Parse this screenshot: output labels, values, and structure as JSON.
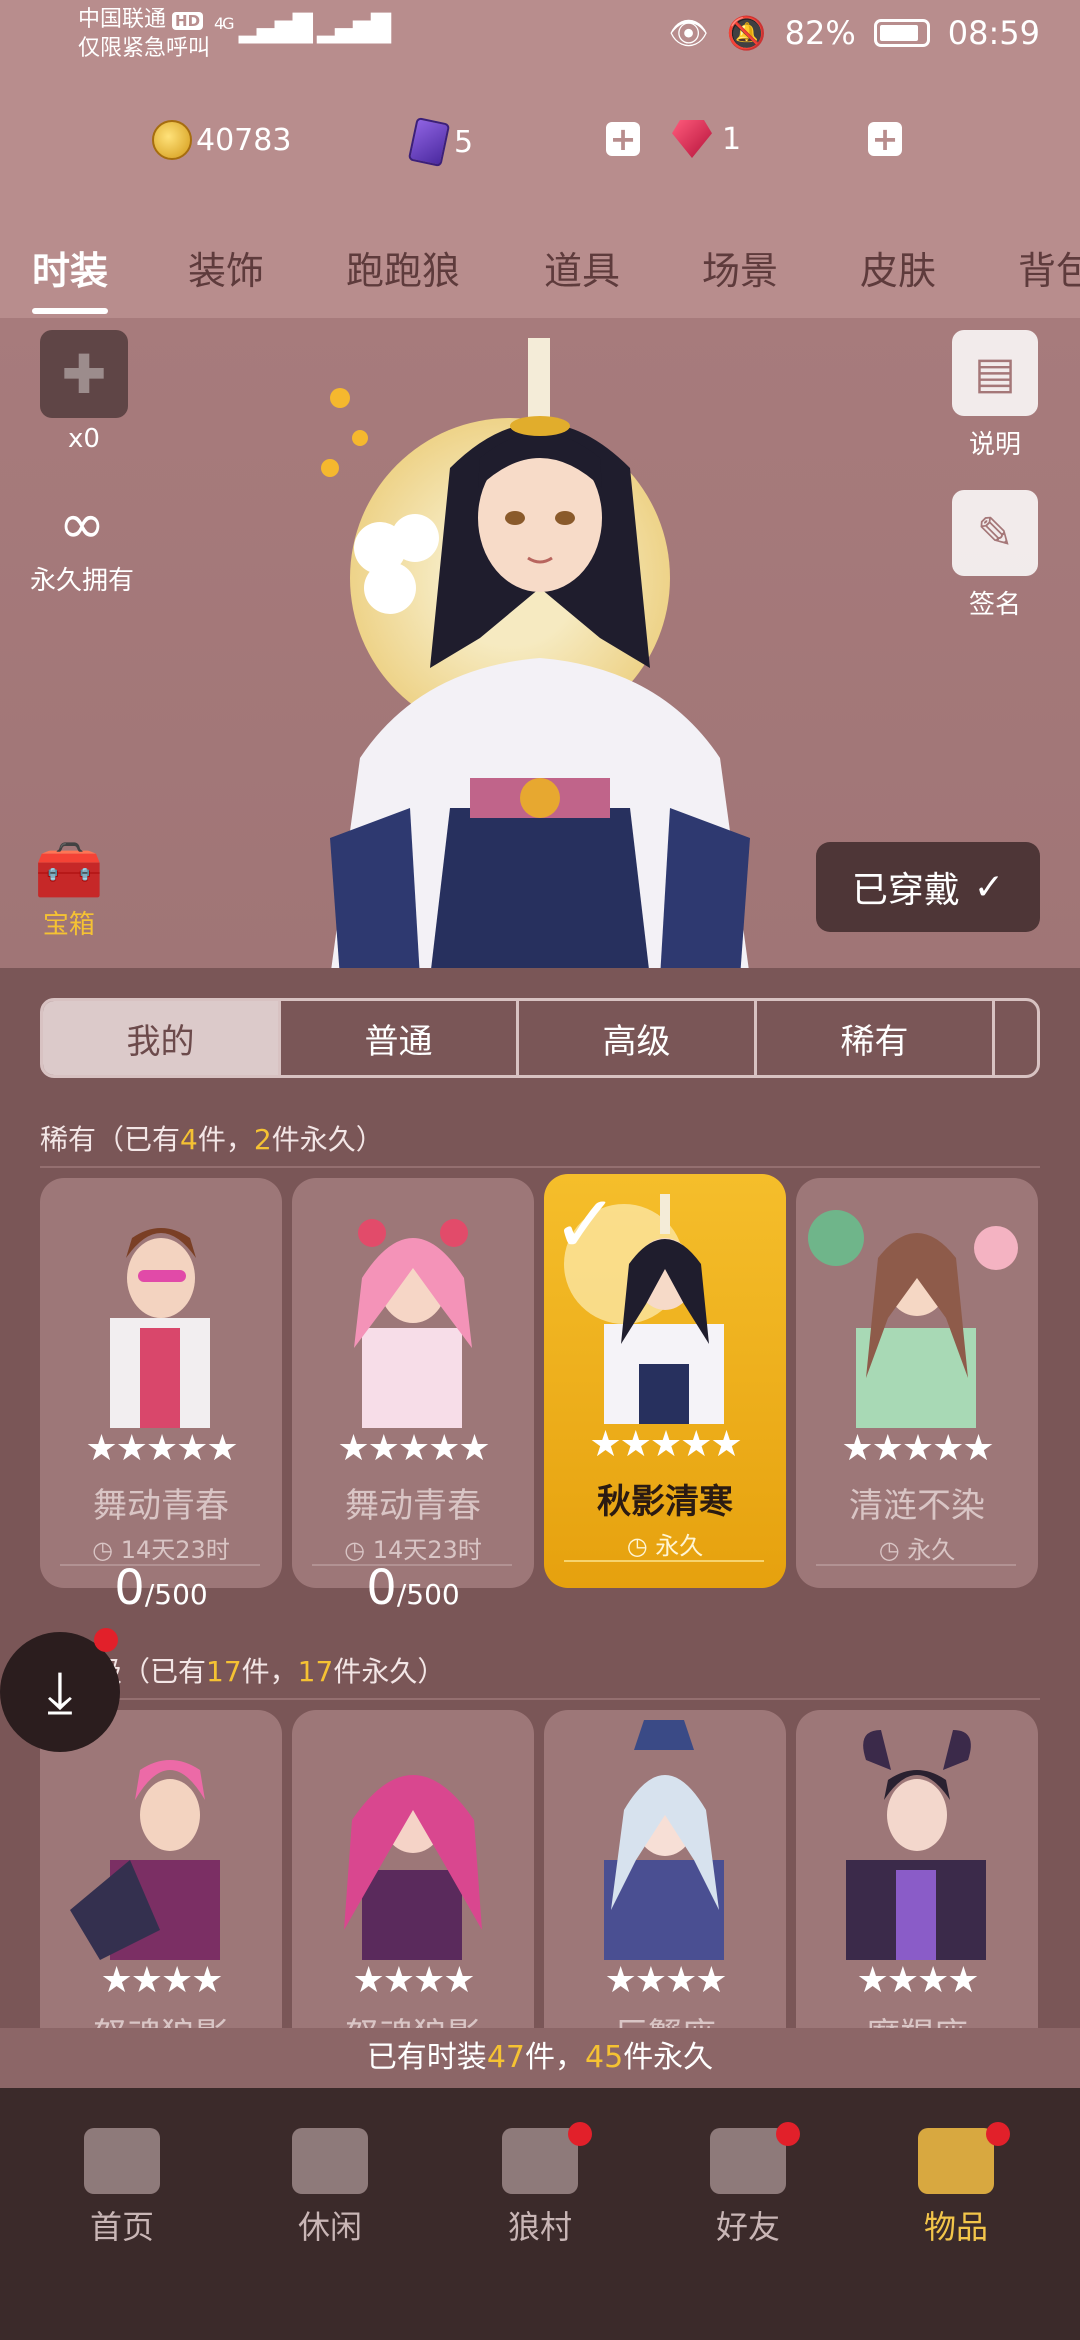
{
  "status_bar": {
    "carrier": "中国联通",
    "carrier_badge": "HD",
    "carrier_sub": "仅限紧急呼叫",
    "network": "4G",
    "battery": "82%",
    "time": "08:59"
  },
  "currency": {
    "gold": "40783",
    "cards": "5",
    "gems": "1"
  },
  "tabs": [
    "时装",
    "装饰",
    "跑跑狼",
    "道具",
    "场景",
    "皮肤",
    "背包"
  ],
  "stage": {
    "puzzle_count": "x0",
    "ownership": "永久拥有",
    "help_label": "说明",
    "sign_label": "签名",
    "chest_label": "宝箱",
    "worn_label": "已穿戴"
  },
  "segments": [
    "我的",
    "普通",
    "高级",
    "稀有"
  ],
  "rare_section": {
    "prefix": "稀有（已有",
    "owned": "4",
    "mid": "件，",
    "perm": "2",
    "suffix": "件永久）"
  },
  "rare_cards": [
    {
      "name": "舞动青春",
      "stars": "★★★★★",
      "time": "14天23时",
      "progress": "0",
      "total": "/500"
    },
    {
      "name": "舞动青春",
      "stars": "★★★★★",
      "time": "14天23时",
      "progress": "0",
      "total": "/500"
    },
    {
      "name": "秋影清寒",
      "stars": "★★★★★",
      "time": "永久"
    },
    {
      "name": "清涟不染",
      "stars": "★★★★★",
      "time": "永久"
    }
  ],
  "advanced_section": {
    "prefix": "级（已有",
    "owned": "17",
    "mid": "件，",
    "perm": "17",
    "suffix": "件永久）"
  },
  "advanced_cards": [
    {
      "name": "怒魂狼影",
      "stars": "★★★★"
    },
    {
      "name": "怒魂狼影",
      "stars": "★★★★"
    },
    {
      "name": "巨蟹座",
      "stars": "★★★★"
    },
    {
      "name": "摩羯座",
      "stars": "★★★★"
    }
  ],
  "summary": {
    "prefix": "已有时装",
    "count": "47",
    "mid": "件，",
    "perm": "45",
    "suffix": "件永久"
  },
  "bottom_nav": [
    "首页",
    "休闲",
    "狼村",
    "好友",
    "物品"
  ],
  "colors": {
    "background": "#7a5657",
    "header": "#b88d8d",
    "accent": "#f5c233",
    "selected_card": "#f5be2b"
  }
}
